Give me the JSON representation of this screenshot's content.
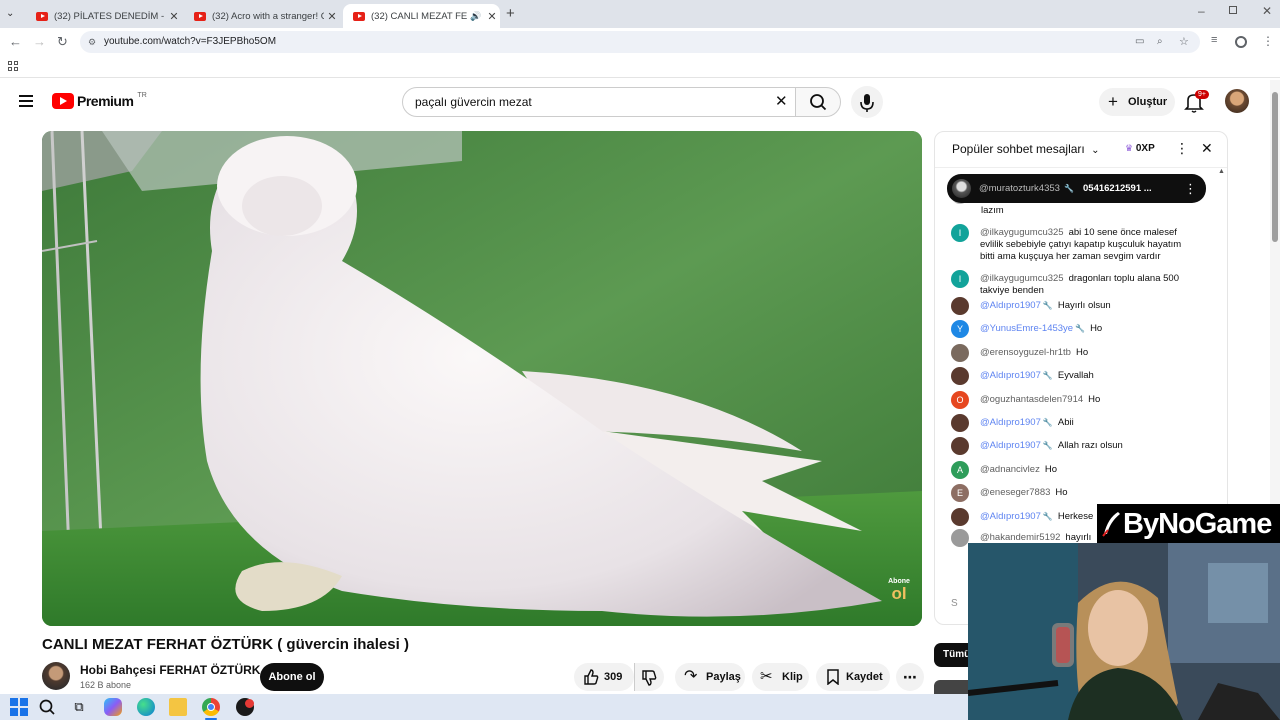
{
  "browser": {
    "tabs": [
      {
        "title": "(32) PİLATES DENEDİM - YouTube",
        "active": false
      },
      {
        "title": "(32) Acro with a stranger! Check",
        "active": false
      },
      {
        "title": "(32) CANLI MEZAT FERHAT",
        "active": true
      }
    ],
    "url": "youtube.com/watch?v=F3JEPBho5OM"
  },
  "header": {
    "logo": "Premium",
    "region": "TR",
    "search_value": "paçalı güvercin mezat",
    "create_label": "Oluştur",
    "notif_count": "9+"
  },
  "video": {
    "title": "CANLI MEZAT FERHAT ÖZTÜRK ( güvercin ihalesi )",
    "overlay_top": "Abone",
    "overlay_bottom": "ol",
    "channel_name": "Hobi Bahçesi FERHAT ÖZTÜRK",
    "subscribers": "162 B abone",
    "subscribe_label": "Abone ol",
    "like_count": "309",
    "share_label": "Paylaş",
    "clip_label": "Klip",
    "save_label": "Kaydet"
  },
  "chat": {
    "header": "Popüler sohbet mesajları",
    "points": "0XP",
    "pinned": {
      "author": "@muratozturk4353",
      "text": "05416212591 ..."
    },
    "partial_text": "lazım",
    "messages": [
      {
        "author": "@ilkaygugumcu325",
        "text": "abi 10 sene önce malesef evlilik sebebiyle çatıyı kapatıp kuşculuk hayatım bitti ama kuşçuya her zaman sevgim vardır",
        "avatar": "I",
        "color": "#12a39a",
        "mod": false
      },
      {
        "author": "@ilkaygugumcu325",
        "text": "dragonları toplu alana 500 takviye benden",
        "avatar": "I",
        "color": "#12a39a",
        "mod": false
      },
      {
        "author": "@Aldıpro1907",
        "text": "Hayırlı olsun",
        "avatar": "",
        "color": "#5a3a2e",
        "mod": true
      },
      {
        "author": "@YunusEmre-1453ye",
        "text": "Ho",
        "avatar": "Y",
        "color": "#1e88e5",
        "mod": true
      },
      {
        "author": "@erensoyguzel-hr1tb",
        "text": "Ho",
        "avatar": "",
        "color": "#7a6a5e",
        "mod": false
      },
      {
        "author": "@Aldıpro1907",
        "text": "Eyvallah",
        "avatar": "",
        "color": "#5a3a2e",
        "mod": true
      },
      {
        "author": "@oguzhantasdelen7914",
        "text": "Ho",
        "avatar": "O",
        "color": "#e6471f",
        "mod": false
      },
      {
        "author": "@Aldıpro1907",
        "text": "Abii",
        "avatar": "",
        "color": "#5a3a2e",
        "mod": true
      },
      {
        "author": "@Aldıpro1907",
        "text": "Allah razı olsun",
        "avatar": "",
        "color": "#5a3a2e",
        "mod": true
      },
      {
        "author": "@adnancivlez",
        "text": "Ho",
        "avatar": "A",
        "color": "#2e9d5a",
        "mod": false
      },
      {
        "author": "@eneseger7883",
        "text": "Ho",
        "avatar": "E",
        "color": "#8d6e63",
        "mod": false
      },
      {
        "author": "@Aldıpro1907",
        "text": "Herkese",
        "avatar": "",
        "color": "#5a3a2e",
        "mod": true
      },
      {
        "author": "@hakandemir5192",
        "text": "hayırlı",
        "avatar": "",
        "color": "#9a9a9a",
        "mod": false
      }
    ],
    "input_placeholder": "S"
  },
  "filter_chip": "Tümü",
  "overlay_brand": "ByNoGame",
  "colors": {
    "accent": "#ff0000",
    "mod_name": "#5e84f1",
    "chip_dark": "#0f0f0f"
  },
  "icons": {
    "taskbar": [
      "windows-icon",
      "search-icon",
      "task-view-icon",
      "copilot-icon",
      "edge-icon",
      "file-explorer-icon",
      "chrome-icon",
      "app-icon"
    ]
  }
}
